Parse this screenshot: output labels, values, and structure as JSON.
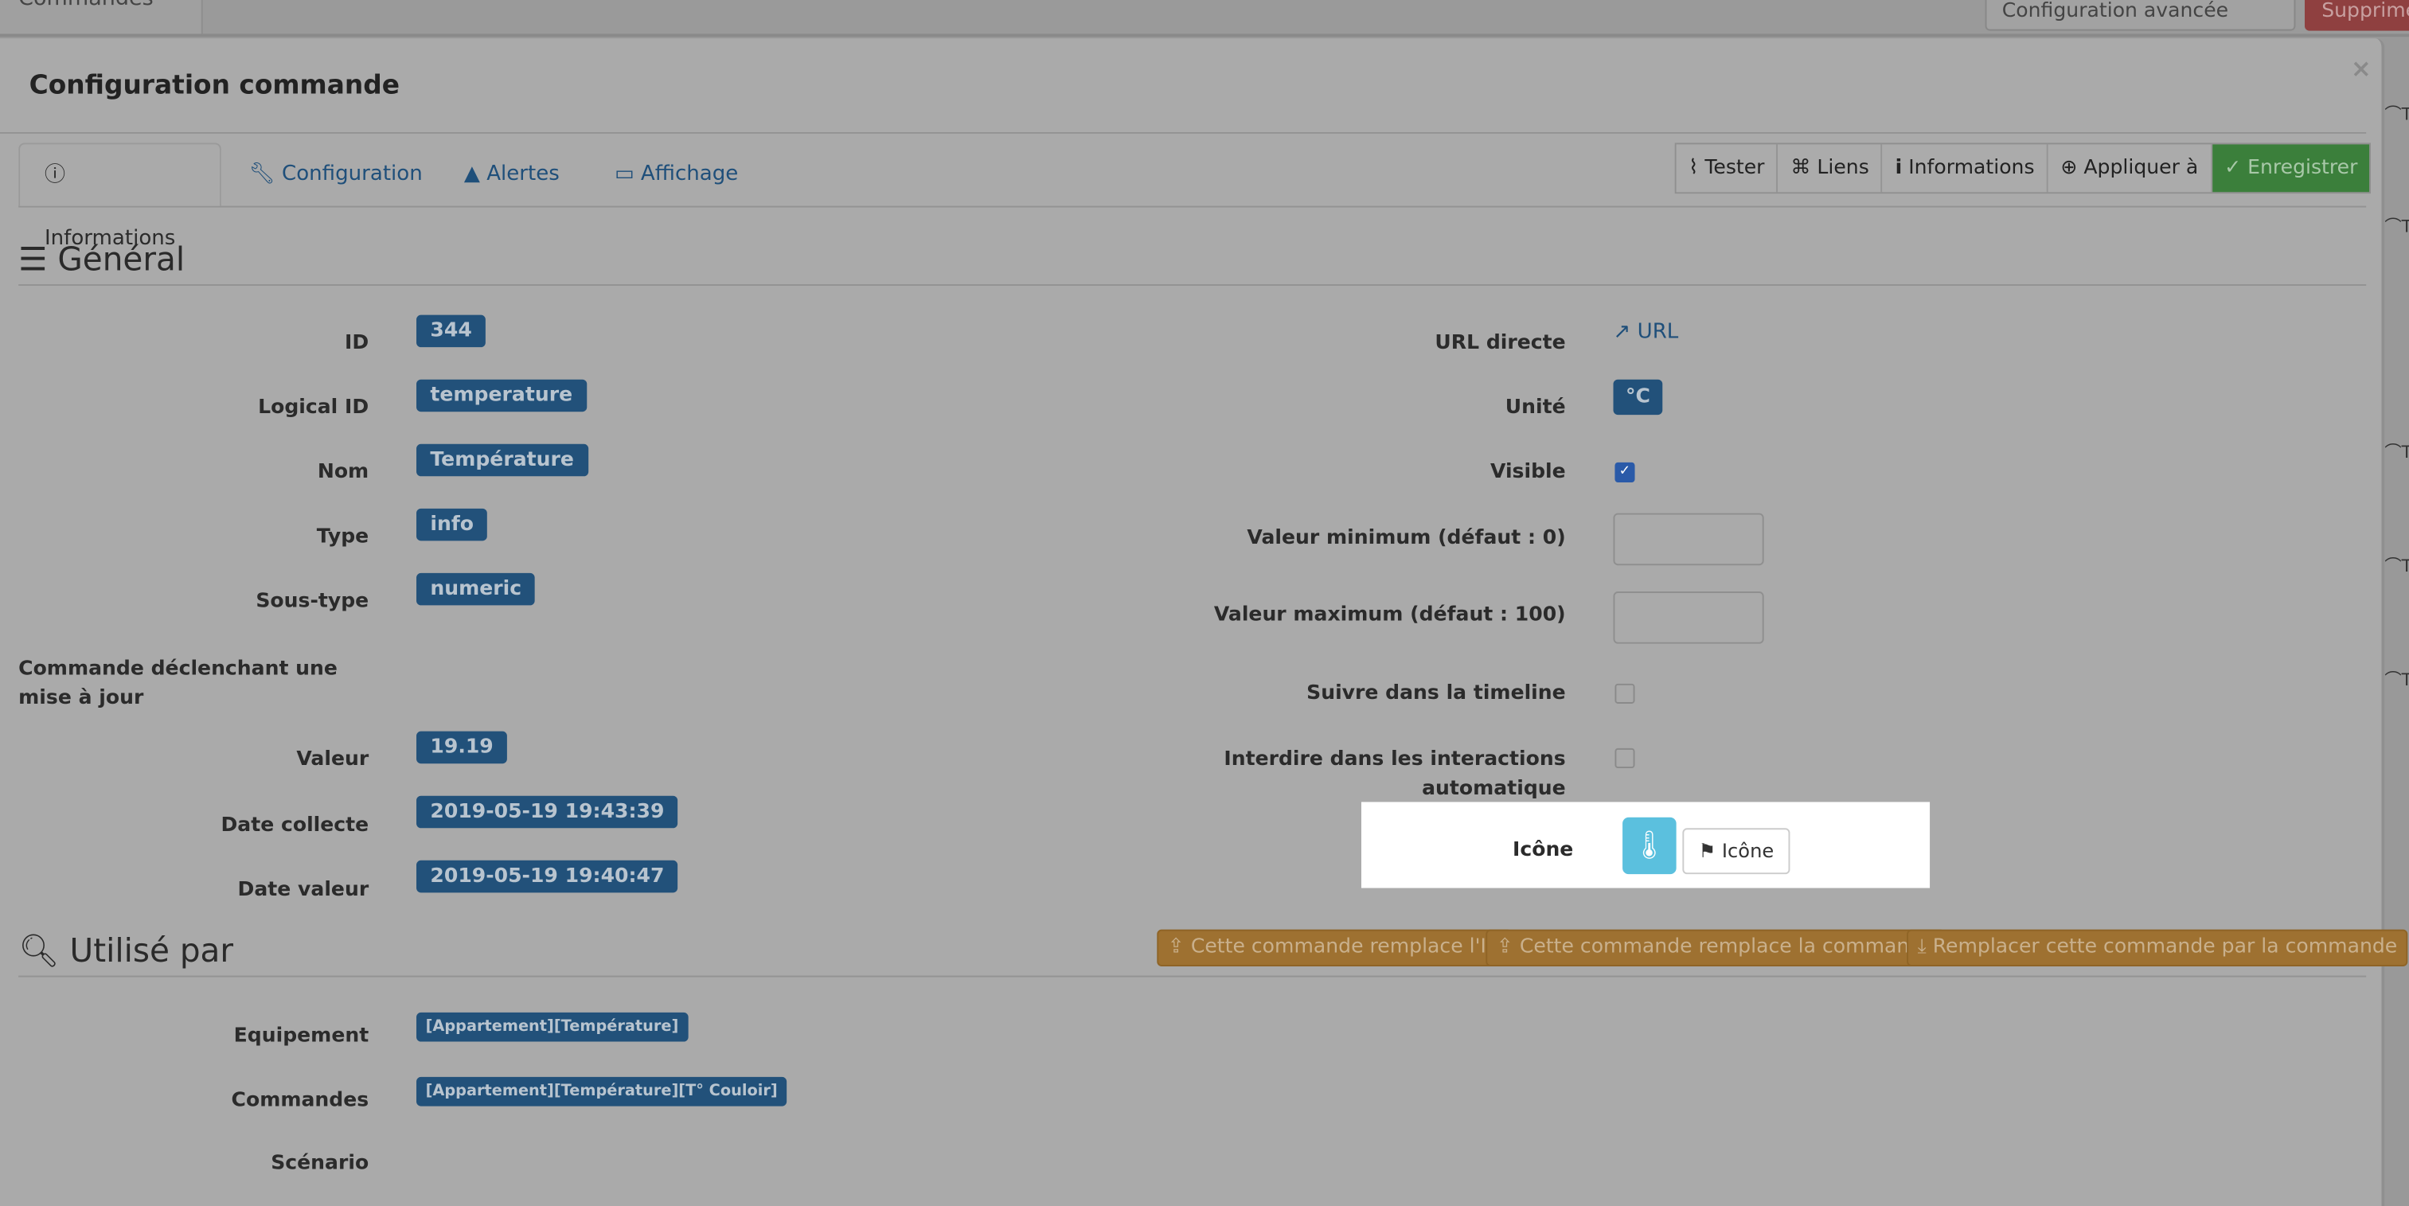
{
  "background": {
    "tab": "Commandes",
    "buttons": [
      "Configuration avancée",
      "Supprimer"
    ]
  },
  "modal": {
    "title": "Configuration commande",
    "close": "×"
  },
  "tabs": [
    {
      "label": "Informations",
      "icon": "info-circle-icon"
    },
    {
      "label": "Configuration",
      "icon": "wrench-icon"
    },
    {
      "label": "Alertes",
      "icon": "warning-icon"
    },
    {
      "label": "Affichage",
      "icon": "desktop-icon"
    }
  ],
  "actions": [
    {
      "label": "Tester",
      "icon": "rss-icon"
    },
    {
      "label": "Liens",
      "icon": "links-icon"
    },
    {
      "label": "Informations",
      "icon": "info-icon"
    },
    {
      "label": "Appliquer à",
      "icon": "plus-circle-icon"
    },
    {
      "label": "Enregistrer",
      "icon": "check-circle-icon"
    }
  ],
  "general": {
    "heading": "Général",
    "left": [
      {
        "label": "ID",
        "value": "344"
      },
      {
        "label": "Logical ID",
        "value": "temperature"
      },
      {
        "label": "Nom",
        "value": "Température"
      },
      {
        "label": "Type",
        "value": "info"
      },
      {
        "label": "Sous-type",
        "value": "numeric"
      },
      {
        "label": "Commande déclenchant une mise à jour",
        "value": ""
      },
      {
        "label": "Valeur",
        "value": "19.19"
      },
      {
        "label": "Date collecte",
        "value": "2019-05-19 19:43:39"
      },
      {
        "label": "Date valeur",
        "value": "2019-05-19 19:40:47"
      }
    ],
    "right": {
      "url_label": "URL directe",
      "url_link": "URL",
      "unit_label": "Unité",
      "unit": "°C",
      "visible_label": "Visible",
      "visible": true,
      "min_label": "Valeur minimum (défaut : 0)",
      "min_value": "",
      "max_label": "Valeur maximum (défaut : 100)",
      "max_value": "",
      "timeline_label": "Suivre dans la timeline",
      "timeline": false,
      "interdire_label": "Interdire dans les interactions automatique",
      "interdire": false,
      "icon_label": "Icône",
      "icon_button": "Icône",
      "icon": "thermometer-icon"
    }
  },
  "used": {
    "heading": "Utilisé par",
    "buttons": [
      "Cette commande remplace l'ID",
      "Cette commande remplace la commande",
      "Remplacer cette commande par la commande"
    ],
    "rows": [
      {
        "label": "Equipement",
        "value": "[Appartement][Température]"
      },
      {
        "label": "Commandes",
        "value": "[Appartement][Température][T° Couloir]"
      },
      {
        "label": "Scénario",
        "value": ""
      }
    ]
  },
  "colors": {
    "badge": "#22517a",
    "save": "#3b7f3b",
    "warning": "#9e7131",
    "icon_bg": "#5bc0de"
  }
}
